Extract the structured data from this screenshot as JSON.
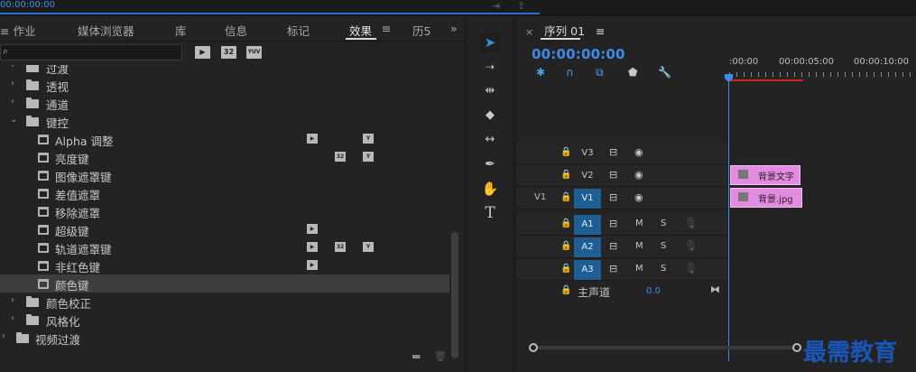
{
  "top_strip": {
    "timecode": "00:00:00:00"
  },
  "effects_panel": {
    "tabs": [
      {
        "label": "≡ 作业"
      },
      {
        "label": "媒体浏览器"
      },
      {
        "label": "库"
      },
      {
        "label": "信息"
      },
      {
        "label": "标记"
      },
      {
        "label": "效果"
      },
      {
        "label": "历5"
      }
    ],
    "tab_menu_glyph": "≡",
    "tabs_overflow": "»",
    "search": {
      "value": "",
      "placeholder": ""
    },
    "filter_badges": [
      "32",
      "YUV"
    ],
    "tree": [
      {
        "label": "过渡",
        "depth": 1,
        "type": "folder",
        "expanded": false
      },
      {
        "label": "透视",
        "depth": 1,
        "type": "folder",
        "expanded": false
      },
      {
        "label": "通道",
        "depth": 1,
        "type": "folder",
        "expanded": false
      },
      {
        "label": "键控",
        "depth": 1,
        "type": "folder",
        "expanded": true
      },
      {
        "label": "Alpha 调整",
        "depth": 2,
        "type": "effect",
        "badges": [
          "accel",
          "yuv"
        ]
      },
      {
        "label": "亮度键",
        "depth": 2,
        "type": "effect",
        "badges": [
          "32",
          "yuv"
        ]
      },
      {
        "label": "图像遮罩键",
        "depth": 2,
        "type": "effect",
        "badges": []
      },
      {
        "label": "差值遮罩",
        "depth": 2,
        "type": "effect",
        "badges": []
      },
      {
        "label": "移除遮罩",
        "depth": 2,
        "type": "effect",
        "badges": []
      },
      {
        "label": "超级键",
        "depth": 2,
        "type": "effect",
        "badges": [
          "accel"
        ]
      },
      {
        "label": "轨道遮罩键",
        "depth": 2,
        "type": "effect",
        "badges": [
          "accel",
          "32",
          "yuv"
        ]
      },
      {
        "label": "非红色键",
        "depth": 2,
        "type": "effect",
        "badges": [
          "accel"
        ]
      },
      {
        "label": "颜色键",
        "depth": 2,
        "type": "effect",
        "badges": [],
        "selected": true
      },
      {
        "label": "颜色校正",
        "depth": 1,
        "type": "folder",
        "expanded": false
      },
      {
        "label": "风格化",
        "depth": 1,
        "type": "folder",
        "expanded": false
      },
      {
        "label": "视频过渡",
        "depth": 0,
        "type": "folder",
        "expanded": false
      }
    ]
  },
  "tools": [
    "selection-tool",
    "track-select-tool",
    "ripple-edit-tool",
    "razor-tool",
    "slip-tool",
    "pen-tool",
    "hand-tool",
    "type-tool"
  ],
  "timeline": {
    "sequence_tab": "序列 01",
    "close_glyph": "×",
    "menu_glyph": "≡",
    "timecode": "00:00:00:00",
    "ruler_labels": [
      ":00:00",
      "00:00:05:00",
      "00:00:10:00"
    ],
    "tracks": [
      {
        "name": "V3",
        "source": "",
        "targeted": false,
        "kind": "video"
      },
      {
        "name": "V2",
        "source": "",
        "targeted": false,
        "kind": "video"
      },
      {
        "name": "V1",
        "source": "V1",
        "targeted": true,
        "kind": "video"
      },
      {
        "name": "A1",
        "source": "",
        "targeted": true,
        "kind": "audio"
      },
      {
        "name": "A2",
        "source": "",
        "targeted": true,
        "kind": "audio"
      },
      {
        "name": "A3",
        "source": "",
        "targeted": true,
        "kind": "audio"
      }
    ],
    "mute_label": "M",
    "solo_label": "S",
    "clips": [
      {
        "track": "V2",
        "label": "背景文字"
      },
      {
        "track": "V1",
        "label": "背景.jpg"
      }
    ],
    "master": {
      "label": "主声道",
      "value": "0.0"
    }
  },
  "watermark": "最需教育"
}
